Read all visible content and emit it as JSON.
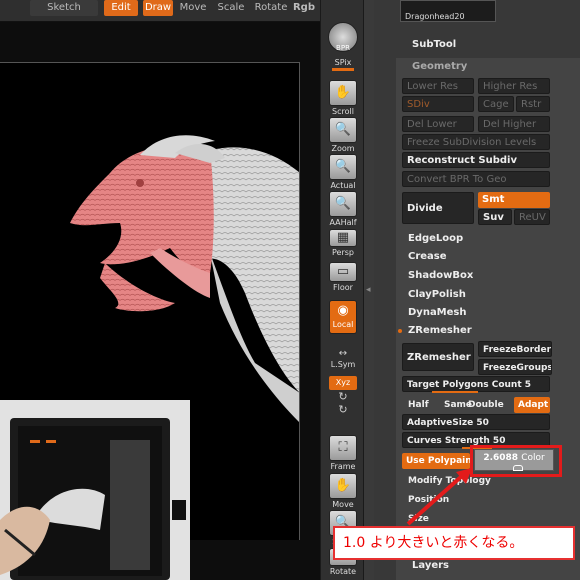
{
  "topbar": {
    "sketch_label": "Sketch",
    "edit_label": "Edit",
    "draw_label": "Draw",
    "move_label": "Move",
    "scale_label": "Scale",
    "rotate_label": "Rotate",
    "rgb_label": "Rgb"
  },
  "shelf": {
    "bpr": "BPR",
    "spix": "SPix",
    "scroll": "Scroll",
    "zoom": "Zoom",
    "actual": "Actual",
    "aahalf": "AAHalf",
    "persp": "Persp",
    "floor": "Floor",
    "local": "Local",
    "lsym": "L.Sym",
    "xyz": "Xyz",
    "frame": "Frame",
    "move": "Move",
    "scale": "Scale",
    "rotate": "Rotate"
  },
  "panel": {
    "tool_name": "Dragonhead20",
    "subtool": "SubTool",
    "geometry": "Geometry",
    "lower_res": "Lower Res",
    "higher_res": "Higher Res",
    "sdiv": "SDiv",
    "cage": "Cage",
    "rstr": "Rstr",
    "del_lower": "Del Lower",
    "del_higher": "Del Higher",
    "freeze_subdiv": "Freeze SubDivision Levels",
    "reconstruct_subdiv": "Reconstruct Subdiv",
    "convert_bpr": "Convert BPR To Geo",
    "divide": "Divide",
    "smt": "Smt",
    "suv": "Suv",
    "reuv": "ReUV",
    "edgeloop": "EdgeLoop",
    "crease": "Crease",
    "shadowbox": "ShadowBox",
    "claypolish": "ClayPolish",
    "dynamesh": "DynaMesh",
    "zremesher_header": "ZRemesher",
    "zremesher_btn": "ZRemesher",
    "freeze_border": "FreezeBorder",
    "freeze_groups": "FreezeGroups",
    "target_polygons": "Target Polygons Count 5",
    "half": "Half",
    "same": "Same",
    "double": "Double",
    "adapt": "Adapt",
    "adaptive_size": "AdaptiveSize 50",
    "curves_strength": "Curves Strength 50",
    "use_polypaint": "Use Polypaint",
    "color_value": "2.6088",
    "color_label": "Color",
    "modify_topology": "Modify Topology",
    "position": "Position",
    "size": "Size",
    "layers": "Layers"
  },
  "annotation": {
    "callout_text": "1.0 より大きいと赤くなる。"
  },
  "colors": {
    "accent_orange": "#e36b12",
    "callout_red": "#e31b1b"
  }
}
